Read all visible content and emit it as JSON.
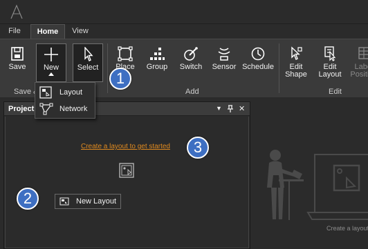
{
  "menubar": {
    "tabs": [
      {
        "label": "File"
      },
      {
        "label": "Home"
      },
      {
        "label": "View"
      }
    ]
  },
  "ribbon": {
    "buttons": {
      "save": "Save",
      "new": "New",
      "select": "Select",
      "place": "Place",
      "group": "Group",
      "switch": "Switch",
      "sensor": "Sensor",
      "schedule": "Schedule",
      "edit_shape_1": "Edit",
      "edit_shape_2": "Shape",
      "edit_layout_1": "Edit",
      "edit_layout_2": "Layout",
      "label_pos_1": "Label",
      "label_pos_2": "Position"
    },
    "groups": {
      "save_new": "Save & New",
      "add": "Add",
      "edit": "Edit"
    }
  },
  "new_dropdown": {
    "items": [
      {
        "label": "Layout"
      },
      {
        "label": "Network"
      }
    ]
  },
  "panel": {
    "title": "Project Explorer",
    "ctrl_menu": "▼",
    "ctrl_pin": "📌",
    "ctrl_close": "✕",
    "empty_link": "Create a layout to get started",
    "new_layout_button": "New Layout"
  },
  "canvas": {
    "hint": "Create a layout"
  },
  "callouts": [
    "1",
    "2",
    "3"
  ],
  "colors": {
    "accent_link": "#e08a1f",
    "callout_fill": "#3e6fc2",
    "ribbon_bg": "#3a3a3a",
    "app_bg": "#2b2b2b"
  }
}
